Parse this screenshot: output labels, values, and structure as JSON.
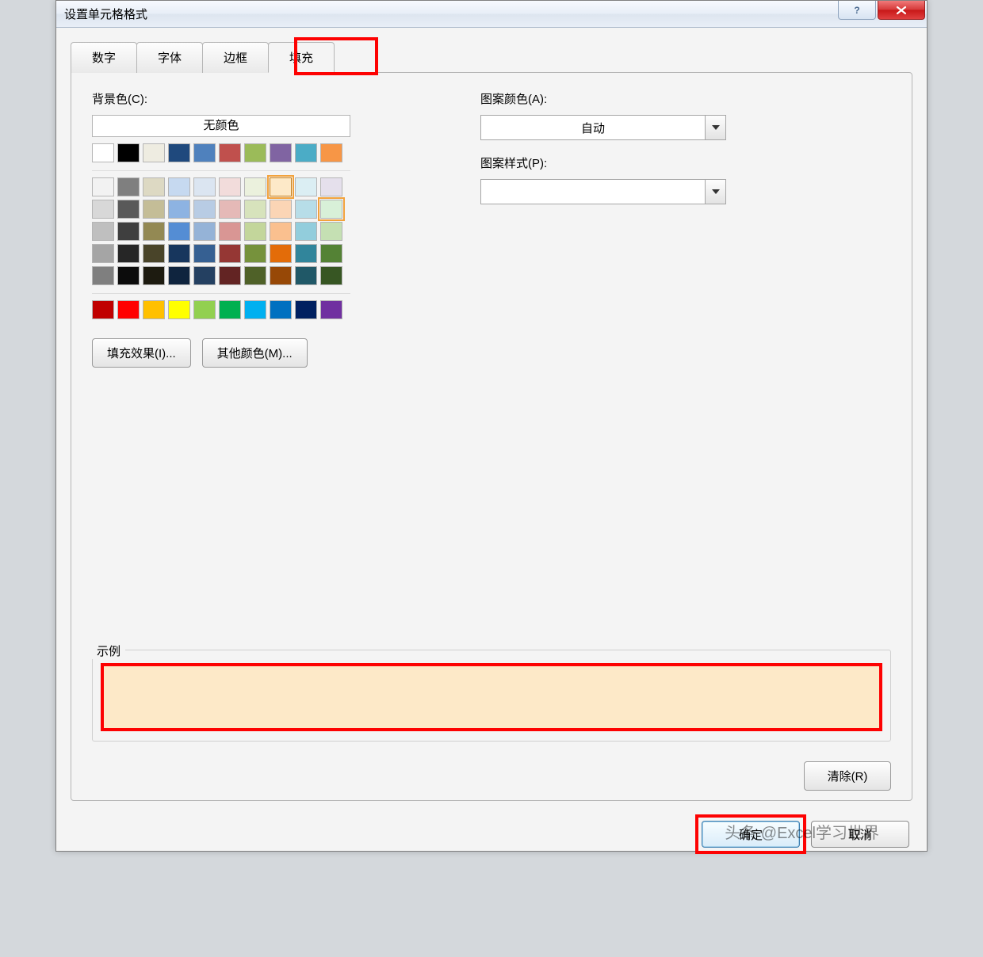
{
  "title": "设置单元格格式",
  "tabs": [
    "数字",
    "字体",
    "边框",
    "填充"
  ],
  "active_tab_index": 3,
  "labels": {
    "background_color": "背景色(C):",
    "no_color": "无颜色",
    "fill_effects": "填充效果(I)...",
    "more_colors": "其他颜色(M)...",
    "pattern_color": "图案颜色(A):",
    "auto": "自动",
    "pattern_style": "图案样式(P):",
    "example": "示例",
    "clear": "清除(R)",
    "ok": "确定",
    "cancel": "取消"
  },
  "selected_color": "#fde9c8",
  "watermark": "头条 @Excel学习世界",
  "color_grid": {
    "row1": [
      "#ffffff",
      "#000000",
      "#eeece1",
      "#1f497d",
      "#4f81bd",
      "#c0504d",
      "#9bbb59",
      "#8064a2",
      "#4bacc6",
      "#f79646"
    ],
    "theme": [
      [
        "#f2f2f2",
        "#7f7f7f",
        "#ddd9c3",
        "#c6d9f0",
        "#dbe5f1",
        "#f2dcdb",
        "#ebf1dd",
        "#fde9c8",
        "#dbeef3",
        "#e5e0ec"
      ],
      [
        "#d8d8d8",
        "#595959",
        "#c4bd97",
        "#8db3e2",
        "#b8cce4",
        "#e5b9b7",
        "#d7e3bc",
        "#fbd5b5",
        "#b7dde8",
        "#d8f0d8"
      ],
      [
        "#bfbfbf",
        "#3f3f3f",
        "#938953",
        "#548dd4",
        "#95b3d7",
        "#d99694",
        "#c3d69b",
        "#fac08f",
        "#92cddc",
        "#c5e0b3"
      ],
      [
        "#a5a5a5",
        "#262626",
        "#494429",
        "#17365d",
        "#366092",
        "#953734",
        "#76923c",
        "#e36c09",
        "#31859b",
        "#548235"
      ],
      [
        "#7f7f7f",
        "#0c0c0c",
        "#1d1b10",
        "#0f243e",
        "#244061",
        "#632423",
        "#4f6128",
        "#974806",
        "#205867",
        "#375623"
      ]
    ],
    "standard": [
      "#c00000",
      "#ff0000",
      "#ffc000",
      "#ffff00",
      "#92d050",
      "#00b050",
      "#00b0f0",
      "#0070c0",
      "#002060",
      "#7030a0"
    ]
  }
}
